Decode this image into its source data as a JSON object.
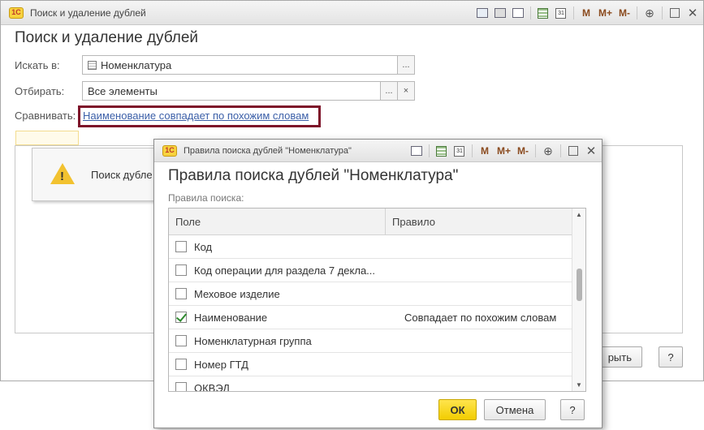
{
  "main": {
    "window_title": "Поиск и удаление дублей",
    "logo_text": "1С",
    "form_title": "Поиск и удаление дублей",
    "search_in_label": "Искать в:",
    "search_in_value": "Номенклатура",
    "filter_label": "Отбирать:",
    "filter_value": "Все элементы",
    "compare_label": "Сравнивать:",
    "compare_link": "Наименование совпадает по похожим словам",
    "warning_text": "Поиск дубле",
    "close_button": "рыть",
    "help_button": "?",
    "ellipsis": "...",
    "clear": "×"
  },
  "toolbar": {
    "m": "M",
    "m_plus": "M+",
    "m_minus": "M-",
    "cal": "31"
  },
  "dialog": {
    "window_title": "Правила поиска дублей \"Номенклатура\"",
    "logo_text": "1С",
    "heading": "Правила поиска дублей \"Номенклатура\"",
    "rules_label": "Правила поиска:",
    "columns": {
      "field": "Поле",
      "rule": "Правило"
    },
    "rows": [
      {
        "field": "Код",
        "rule": "",
        "checked": false
      },
      {
        "field": "Код операции для раздела 7 декла...",
        "rule": "",
        "checked": false
      },
      {
        "field": "Меховое изделие",
        "rule": "",
        "checked": false
      },
      {
        "field": "Наименование",
        "rule": "Совпадает по похожим словам",
        "checked": true
      },
      {
        "field": "Номенклатурная группа",
        "rule": "",
        "checked": false
      },
      {
        "field": "Номер ГТД",
        "rule": "",
        "checked": false
      },
      {
        "field": "ОКВЭД",
        "rule": "",
        "checked": false
      }
    ],
    "ok_button": "ОК",
    "cancel_button": "Отмена",
    "help_button": "?"
  },
  "colors": {
    "link": "#3b5fa8",
    "highlight_border": "#7d1229",
    "ok_button": "#f2cd00",
    "checkmark": "#2f8a2f",
    "warning": "#f2c230"
  }
}
